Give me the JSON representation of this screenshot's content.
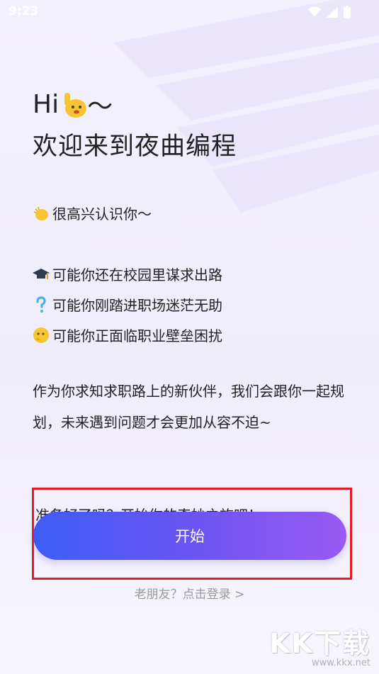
{
  "status_bar": {
    "time": "9:23"
  },
  "greeting": {
    "hi": "Hi",
    "tilde": "～",
    "welcome": "欢迎来到夜曲编程"
  },
  "messages": {
    "nice_to_meet": "很高兴认识你～",
    "campus": "可能你还在校园里谋求出路",
    "new_job": "可能你刚踏进职场迷茫无助",
    "career_trouble": "可能你正面临职业壁垒困扰",
    "partner_paragraph": "作为你求知求职路上的新伙伴，我们会跟你一起规划，未来遇到问题才会更加从容不迫~",
    "ready_behind": "准备好了吗？开始你的奇妙之旅吧！"
  },
  "actions": {
    "start": "开始",
    "login": "老朋友？点击登录 >"
  },
  "watermark": {
    "logo": "KK下载",
    "url": "www.kkx.net"
  },
  "colors": {
    "button_start": "#3d5cf5",
    "button_end": "#9a59f3",
    "highlight": "#e31c2a"
  },
  "icons": [
    "wave-hand-icon",
    "clap-icon",
    "grad-cap-icon",
    "question-icon",
    "thinking-face-icon",
    "wifi-icon",
    "signal-icon",
    "battery-icon"
  ]
}
